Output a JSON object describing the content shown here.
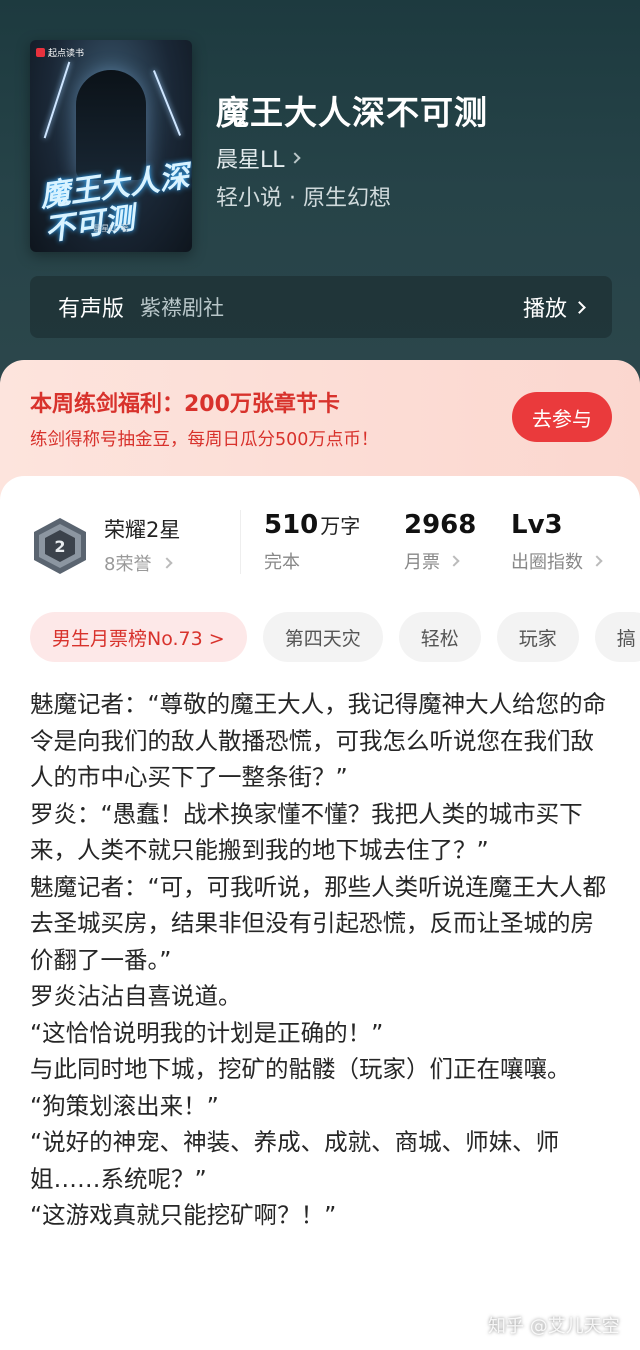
{
  "book": {
    "cover_brand": "起点读书",
    "cover_title": "魔王大人深不可测",
    "cover_author": "晨星LL 著",
    "title": "魔王大人深不可测",
    "author": "晨星LL",
    "genre": "轻小说 · 原生幻想"
  },
  "audio": {
    "label": "有声版",
    "studio": "紫襟剧社",
    "play": "播放"
  },
  "welfare": {
    "title": "本周练剑福利：200万张章节卡",
    "subtitle": "练剑得称号抽金豆，每周日瓜分500万点币！",
    "button": "去参与"
  },
  "honor": {
    "badge_number": "2",
    "name": "荣耀2星",
    "sub": "8荣誉"
  },
  "stats": [
    {
      "value": "510",
      "unit": "万字",
      "label": "完本"
    },
    {
      "value": "2968",
      "unit": "",
      "label": "月票"
    },
    {
      "value": "Lv3",
      "unit": "",
      "label": "出圈指数"
    }
  ],
  "tags": [
    "男生月票榜No.73 >",
    "第四天灾",
    "轻松",
    "玩家",
    "搞"
  ],
  "synopsis": [
    "魅魔记者：“尊敬的魔王大人，我记得魔神大人给您的命令是向我们的敌人散播恐慌，可我怎么听说您在我们敌人的市中心买下了一整条街？”",
    "罗炎：“愚蠢！战术换家懂不懂？我把人类的城市买下来，人类不就只能搬到我的地下城去住了？”",
    "魅魔记者：“可，可我听说，那些人类听说连魔王大人都去圣城买房，结果非但没有引起恐慌，反而让圣城的房价翻了一番。”",
    "罗炎沾沾自喜说道。",
    "“这恰恰说明我的计划是正确的！”",
    "与此同时地下城，挖矿的骷髅（玩家）们正在嚷嚷。",
    "“狗策划滚出来！”",
    "“说好的神宠、神装、养成、成就、商城、师妹、师姐……系统呢？”",
    "“这游戏真就只能挖矿啊？！”"
  ],
  "watermark": "知乎 @艾儿天空",
  "colors": {
    "accent_red": "#ea3a3c",
    "hero_bg": "#264348",
    "welfare_bg": "#fde4dd"
  }
}
